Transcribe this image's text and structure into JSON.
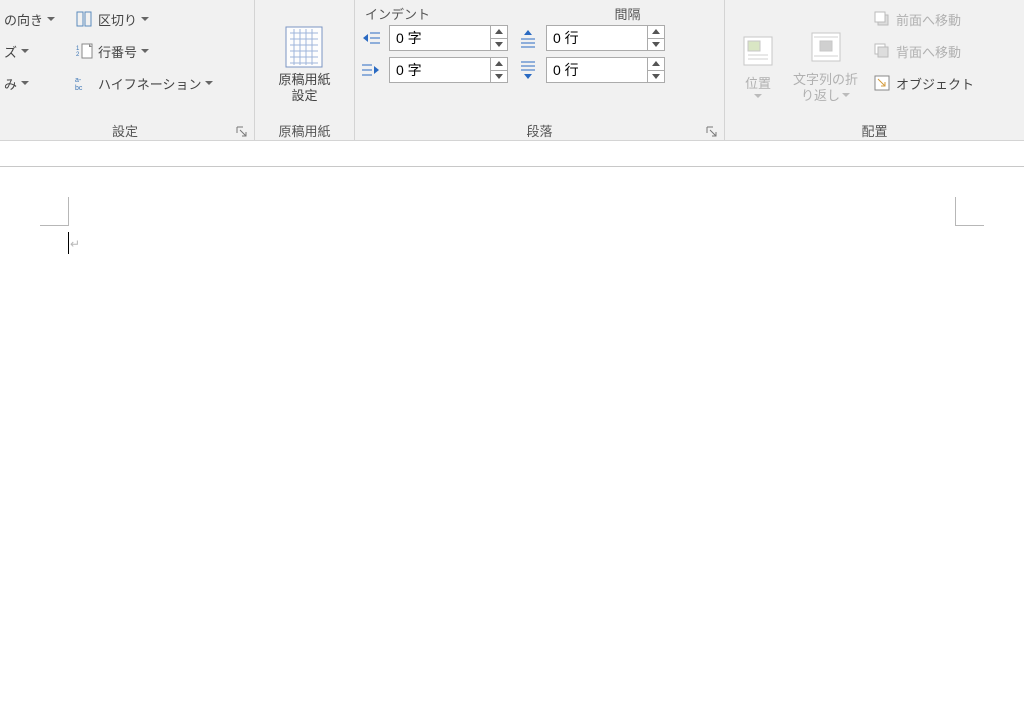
{
  "pageSetup": {
    "orientation": "の向き",
    "size": "ズ",
    "columns": "み",
    "breaks": "区切り",
    "lineNumbers": "行番号",
    "hyphenation": "ハイフネーション",
    "groupLabel": "設定"
  },
  "manuscript": {
    "line1": "原稿用紙",
    "line2": "設定",
    "groupLabel": "原稿用紙"
  },
  "paragraph": {
    "indentTitle": "インデント",
    "spacingTitle": "間隔",
    "left": {
      "value": "0 字"
    },
    "right": {
      "value": "0 字"
    },
    "before": {
      "value": "0 行"
    },
    "after": {
      "value": "0 行"
    },
    "groupLabel": "段落"
  },
  "arrange": {
    "position": "位置",
    "wrap1": "文字列の折",
    "wrap2": "り返し",
    "bringForward": "前面へ移動",
    "sendBackward": "背面へ移動",
    "object": "オブジェクト",
    "groupLabel": "配置"
  }
}
